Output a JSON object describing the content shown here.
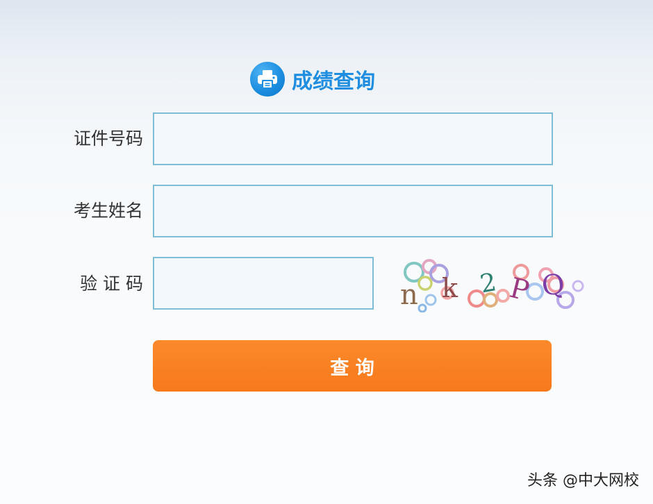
{
  "header": {
    "title": "成绩查询",
    "icon": "printer-icon",
    "accent_color": "#1f8ee0"
  },
  "form": {
    "id_number": {
      "label": "证件号码",
      "value": "",
      "placeholder": ""
    },
    "candidate_name": {
      "label": "考生姓名",
      "value": "",
      "placeholder": ""
    },
    "captcha": {
      "label": "验 证 码",
      "value": "",
      "placeholder": "",
      "image_text": "nk2PQ"
    },
    "submit_label": "查 询",
    "submit_color": "#f7791b"
  },
  "watermark": {
    "text": "头条 @中大网校"
  }
}
